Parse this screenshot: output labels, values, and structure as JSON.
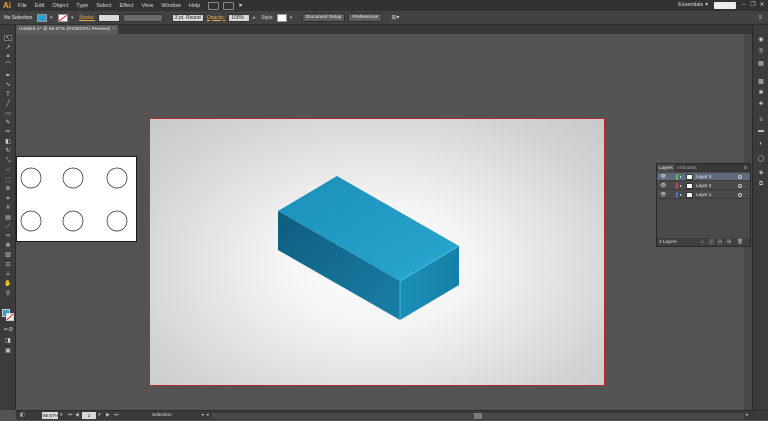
{
  "app": {
    "logo": "Ai"
  },
  "menu": [
    "File",
    "Edit",
    "Object",
    "Type",
    "Select",
    "Effect",
    "View",
    "Window",
    "Help"
  ],
  "workspace": {
    "label": "Essentials"
  },
  "window_controls": {
    "minimize": "–",
    "restore": "❐",
    "close": "✕"
  },
  "control_bar": {
    "selection": "No Selection",
    "fill_color": "#2aa3cf",
    "stroke_label": "Stroke:",
    "brush": "3 pt. Round",
    "opacity_label": "Opacity:",
    "opacity_value": "100%",
    "style_label": "Style:",
    "document_setup": "Document Setup",
    "preferences": "Preferences"
  },
  "document": {
    "tab_title": "Untitled-1* @ 66.67% (RGB/GPU Preview)",
    "close": "×"
  },
  "layers_panel": {
    "tabs": [
      "Layers",
      "Artboards"
    ],
    "menu_icon": "≡",
    "layers": [
      {
        "name": "Layer 3",
        "color": "#4fc24f",
        "selected": true
      },
      {
        "name": "Layer 2",
        "color": "#d04040",
        "selected": false
      },
      {
        "name": "Layer 1",
        "color": "#4a6fd8",
        "selected": false
      }
    ],
    "count": "3 Layers"
  },
  "status_bar": {
    "zoom": "66.67%",
    "page": "1",
    "tool": "Selection"
  },
  "colors": {
    "accent": "#2aa3cf",
    "artboard_border": "#b52a2a",
    "ui_bg": "#535353"
  }
}
